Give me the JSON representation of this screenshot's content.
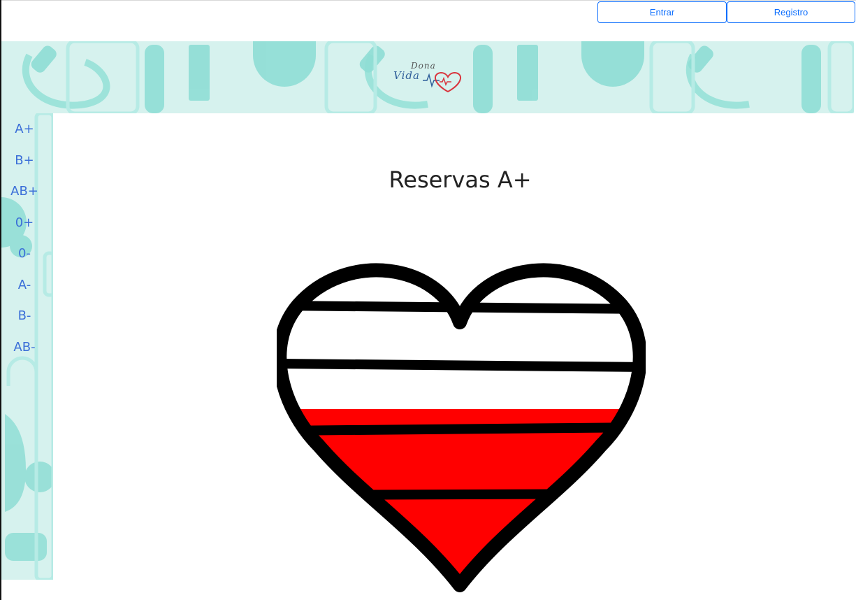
{
  "header": {
    "login_label": "Entrar",
    "register_label": "Registro"
  },
  "logo": {
    "line1": "Dona",
    "line2": "Vida",
    "icon": "heart-pulse-icon"
  },
  "sidebar": {
    "items": [
      {
        "label": "A+"
      },
      {
        "label": "B+"
      },
      {
        "label": "AB+"
      },
      {
        "label": "0+"
      },
      {
        "label": "0-"
      },
      {
        "label": "A-"
      },
      {
        "label": "B-"
      },
      {
        "label": "AB-"
      }
    ]
  },
  "main": {
    "title": "Reservas A+",
    "reserve_level_fraction": 0.6,
    "colors": {
      "blood": "#ff0000",
      "outline": "#000000",
      "empty": "#ffffff"
    }
  },
  "theme": {
    "banner_bg": "#d6f2ee",
    "pattern": "#8fded5",
    "link": "#3b6fd8",
    "button": "#0d6efd"
  }
}
